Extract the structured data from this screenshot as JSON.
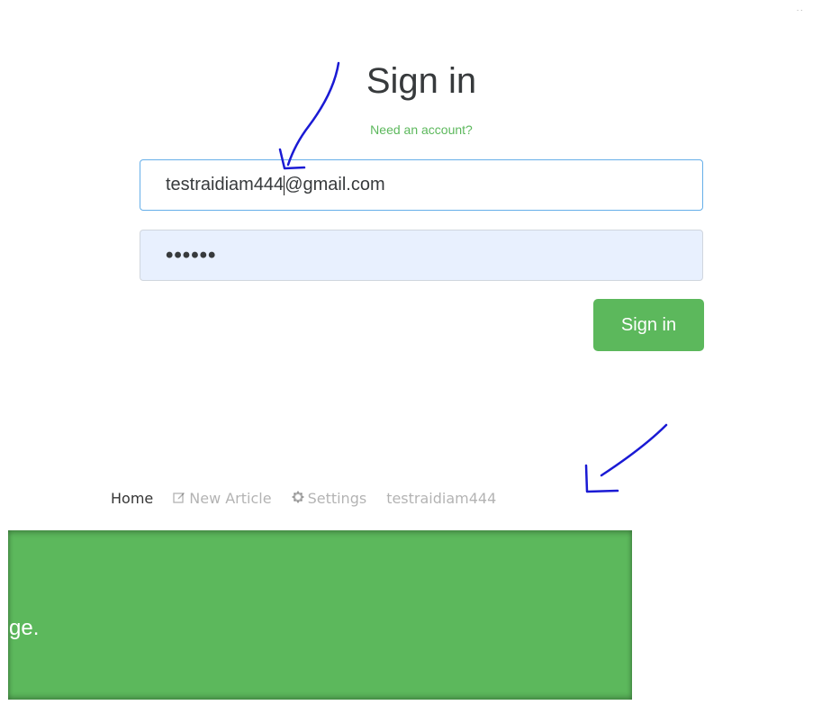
{
  "page": {
    "title": "Sign in",
    "need_account_link": "Need an account?"
  },
  "form": {
    "email_before_caret": "testraidiam444",
    "email_after_caret": "@gmail.com",
    "password_masked": "••••••",
    "submit_label": "Sign in"
  },
  "navbar": {
    "items": [
      {
        "label": "Home",
        "icon": "",
        "active": true
      },
      {
        "label": "New Article",
        "icon": "edit-icon",
        "active": false
      },
      {
        "label": "Settings",
        "icon": "gear-icon",
        "active": false
      },
      {
        "label": "testraidiam444",
        "icon": "",
        "active": false
      }
    ]
  },
  "banner": {
    "text_fragment": "ge."
  },
  "colors": {
    "brand_green": "#5cb85c",
    "annotation_blue": "#1a1ad4",
    "focus_border": "#66afe9"
  },
  "icons": {
    "new_article": "edit-icon",
    "settings": "gear-icon"
  }
}
